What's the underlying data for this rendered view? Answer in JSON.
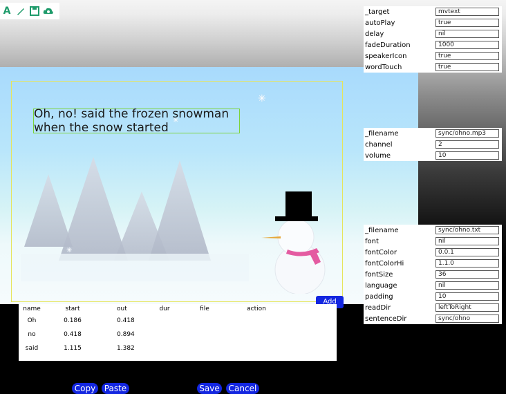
{
  "toolbar": {
    "icons": [
      "text-tool-icon",
      "brush-tool-icon",
      "save-tool-icon",
      "cloud-tool-icon"
    ],
    "accent": "#1f9b6b"
  },
  "stage": {
    "caption": "Oh, no! said the frozen snowman when the snow started"
  },
  "panel_text": {
    "rows": [
      {
        "key": "_target",
        "value": "mvtext"
      },
      {
        "key": "autoPlay",
        "value": "true"
      },
      {
        "key": "delay",
        "value": "nil"
      },
      {
        "key": "fadeDuration",
        "value": "1000"
      },
      {
        "key": "speakerIcon",
        "value": "true"
      },
      {
        "key": "wordTouch",
        "value": "true"
      }
    ]
  },
  "panel_audio": {
    "rows": [
      {
        "key": "_filename",
        "value": "sync/ohno.mp3"
      },
      {
        "key": "channel",
        "value": "2"
      },
      {
        "key": "volume",
        "value": "10"
      }
    ]
  },
  "panel_font": {
    "rows": [
      {
        "key": "_filename",
        "value": "sync/ohno.txt"
      },
      {
        "key": "font",
        "value": "nil"
      },
      {
        "key": "fontColor",
        "value": "0.0.1"
      },
      {
        "key": "fontColorHi",
        "value": "1.1.0"
      },
      {
        "key": "fontSize",
        "value": "36"
      },
      {
        "key": "language",
        "value": "nil"
      },
      {
        "key": "padding",
        "value": "10"
      },
      {
        "key": "readDir",
        "value": "leftToRight"
      },
      {
        "key": "sentenceDir",
        "value": "sync/ohno"
      }
    ]
  },
  "table": {
    "headers": [
      "name",
      "start",
      "out",
      "dur",
      "file",
      "action"
    ],
    "rows": [
      [
        "Oh",
        "0.186",
        "0.418",
        "",
        "",
        ""
      ],
      [
        "no",
        "0.418",
        "0.894",
        "",
        "",
        ""
      ],
      [
        "said",
        "1.115",
        "1.382",
        "",
        "",
        ""
      ]
    ]
  },
  "buttons": {
    "add": "Add",
    "copy": "Copy",
    "paste": "Paste",
    "save": "Save",
    "cancel": "Cancel",
    "color": "#1326e0"
  }
}
